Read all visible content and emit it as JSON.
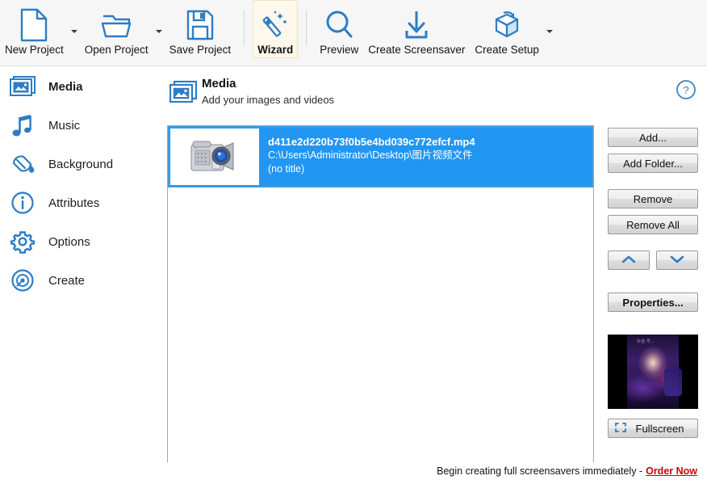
{
  "colors": {
    "accent_blue": "#2d7dc4",
    "selection_blue": "#2196f3",
    "toolbar_bg": "#f6f6f6",
    "order_red": "#cc0000"
  },
  "toolbar": {
    "buttons": [
      {
        "label": "New Project",
        "icon": "new-document-icon",
        "has_caret": true,
        "active": false
      },
      {
        "label": "Open Project",
        "icon": "open-folder-icon",
        "has_caret": true,
        "active": false
      },
      {
        "label": "Save Project",
        "icon": "floppy-save-icon",
        "has_caret": false,
        "active": false
      },
      {
        "label": "Wizard",
        "icon": "magic-wand-icon",
        "has_caret": false,
        "active": true
      },
      {
        "label": "Preview",
        "icon": "magnifier-icon",
        "has_caret": false,
        "active": false
      },
      {
        "label": "Create Screensaver",
        "icon": "download-arrow-icon",
        "has_caret": false,
        "active": false
      },
      {
        "label": "Create Setup",
        "icon": "package-box-icon",
        "has_caret": true,
        "active": false
      }
    ]
  },
  "sidebar": {
    "items": [
      {
        "label": "Media",
        "icon": "media-picture-icon",
        "selected": true
      },
      {
        "label": "Music",
        "icon": "music-note-icon",
        "selected": false
      },
      {
        "label": "Background",
        "icon": "paint-roller-icon",
        "selected": false
      },
      {
        "label": "Attributes",
        "icon": "info-circle-icon",
        "selected": false
      },
      {
        "label": "Options",
        "icon": "gear-icon",
        "selected": false
      },
      {
        "label": "Create",
        "icon": "disc-icon",
        "selected": false
      }
    ]
  },
  "content_header": {
    "icon": "media-picture-icon",
    "title": "Media",
    "subtitle": "Add your images and videos",
    "help_icon": "help-question-icon"
  },
  "media_list": {
    "rows": [
      {
        "thumb_icon": "video-camcorder-icon",
        "name": "d411e2d220b73f0b5e4bd039c772efcf.mp4",
        "path": "C:\\Users\\Administrator\\Desktop\\图片视频文件",
        "title": "(no title)",
        "selected": true
      }
    ]
  },
  "right_panel": {
    "add_label": "Add...",
    "add_folder_label": "Add Folder...",
    "remove_label": "Remove",
    "remove_all_label": "Remove All",
    "move_up_icon": "chevron-up-icon",
    "move_down_icon": "chevron-down-icon",
    "properties_label": "Properties...",
    "fullscreen_label": "Fullscreen",
    "fullscreen_icon": "fullscreen-expand-icon",
    "preview_watermark": "抖音\n号..."
  },
  "status_bar": {
    "message": "Begin creating full screensavers immediately -",
    "order_link": "Order Now"
  }
}
